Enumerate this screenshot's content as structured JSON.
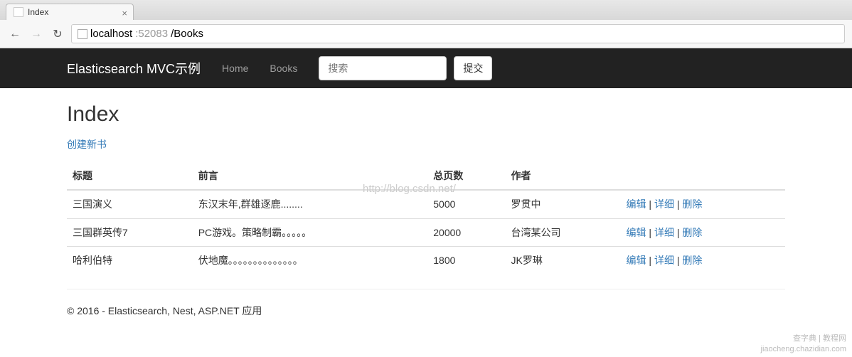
{
  "browser": {
    "tab_title": "Index",
    "url_host": "localhost",
    "url_port": ":52083",
    "url_path": "/Books"
  },
  "navbar": {
    "brand": "Elasticsearch MVC示例",
    "links": [
      {
        "label": "Home"
      },
      {
        "label": "Books"
      }
    ],
    "search_placeholder": "搜索",
    "submit_label": "提交"
  },
  "page": {
    "heading": "Index",
    "create_link": "创建新书",
    "watermark": "http://blog.csdn.net/",
    "footer": "© 2016 - Elasticsearch, Nest, ASP.NET 应用",
    "bottom_mark_1": "查字典 | 教程网",
    "bottom_mark_2": "jiaocheng.chazidian.com"
  },
  "table": {
    "headers": {
      "title": "标题",
      "preface": "前言",
      "pages": "总页数",
      "author": "作者"
    },
    "actions": {
      "edit": "编辑",
      "details": "详细",
      "delete": "删除"
    },
    "rows": [
      {
        "title": "三国演义",
        "preface": "东汉末年,群雄逐鹿........",
        "pages": "5000",
        "author": "罗贯中"
      },
      {
        "title": "三国群英传7",
        "preface": "PC游戏。策略制霸。。。。。",
        "pages": "20000",
        "author": "台湾某公司"
      },
      {
        "title": "哈利伯特",
        "preface": "伏地魔。。。。。。。。。。。。。。",
        "pages": "1800",
        "author": "JK罗琳"
      }
    ]
  }
}
